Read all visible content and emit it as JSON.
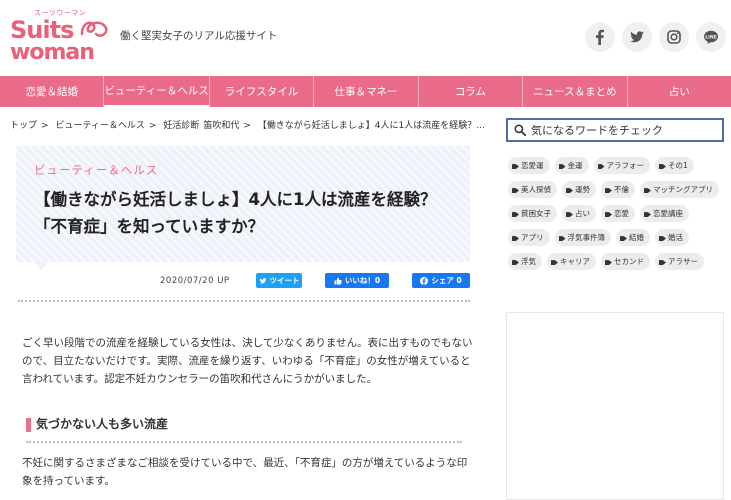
{
  "header": {
    "logo_sub": "スーツウーマン",
    "logo_line1": "Suits",
    "logo_line2": "woman",
    "tagline": "働く堅実女子のリアル応援サイト"
  },
  "social": [
    {
      "name": "facebook-icon",
      "label": "f"
    },
    {
      "name": "twitter-icon",
      "label": "t"
    },
    {
      "name": "instagram-icon",
      "label": "i"
    },
    {
      "name": "line-icon",
      "label": "LINE"
    }
  ],
  "nav": {
    "items": [
      {
        "label": "恋愛＆結婚"
      },
      {
        "label": "ビューティー＆ヘルス"
      },
      {
        "label": "ライフスタイル"
      },
      {
        "label": "仕事＆マネー"
      },
      {
        "label": "コラム"
      },
      {
        "label": "ニュース＆まとめ"
      },
      {
        "label": "占い"
      }
    ]
  },
  "breadcrumb": {
    "items": [
      "トップ",
      "ビューティー＆ヘルス",
      "妊活診断",
      "笛吹和代",
      "【働きながら妊活しましょ】4人に1人は流産を経験？..."
    ],
    "separator": ">"
  },
  "article": {
    "category": "ビューティー＆ヘルス",
    "title": "【働きながら妊活しましょ】4人に1人は流産を経験？「不育症」を知っていますか？",
    "date": "2020/07/20 UP",
    "tweet_label": "ツイート",
    "like_label": "いいね！0",
    "share_label": "シェア 0",
    "paragraph1": "ごく早い段階での流産を経験している女性は、決して少なくありません。表に出すものでもないので、目立たないだけです。実際、流産を繰り返す、いわゆる「不育症」の女性が増えていると言われています。認定不妊カウンセラーの笛吹和代さんにうかがいました。",
    "section_heading": "気づかない人も多い流産",
    "paragraph2": "不妊に関するさまざまなご相談を受けている中で、最近、「不育症」の方が増えているような印象を持っています。"
  },
  "sidebar": {
    "search_placeholder": "気になるワードをチェック",
    "tags": [
      "恋愛運",
      "金運",
      "アラフォー",
      "その1",
      "美人探偵",
      "運勢",
      "不倫",
      "マッチングアプリ",
      "貧困女子",
      "占い",
      "恋愛",
      "恋愛講座",
      "アプリ",
      "浮気事件簿",
      "結婚",
      "婚活",
      "浮気",
      "キャリア",
      "セカンド",
      "アラサー"
    ]
  },
  "colors": {
    "brand_pink": "#ea6a8a",
    "twitter_blue": "#1da1f2",
    "facebook_blue": "#1877f2",
    "search_border": "#4a6fa5"
  }
}
